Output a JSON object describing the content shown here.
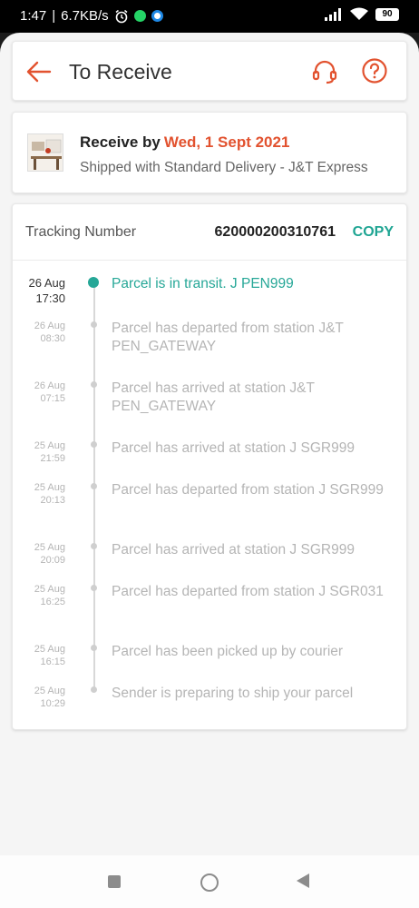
{
  "status_bar": {
    "time": "1:47",
    "separator": "|",
    "speed": "6.7KB/s",
    "battery": "90"
  },
  "header": {
    "title": "To Receive"
  },
  "delivery": {
    "title_prefix": "Receive by",
    "date": "Wed, 1 Sept 2021",
    "subtitle": "Shipped with Standard Delivery  - J&T Express"
  },
  "tracking": {
    "label": "Tracking Number",
    "number": "620000200310761",
    "copy_label": "COPY",
    "events": [
      {
        "date": "26 Aug",
        "time": "17:30",
        "text": "Parcel is in transit. J PEN999"
      },
      {
        "date": "26 Aug",
        "time": "08:30",
        "text": "Parcel has departed from station J&T PEN_GATEWAY"
      },
      {
        "date": "26 Aug",
        "time": "07:15",
        "text": "Parcel has arrived at station J&T PEN_GATEWAY"
      },
      {
        "date": "25 Aug",
        "time": "21:59",
        "text": "Parcel has arrived at station J SGR999"
      },
      {
        "date": "25 Aug",
        "time": "20:13",
        "text": "Parcel has departed from station J SGR999"
      },
      {
        "date": "25 Aug",
        "time": "20:09",
        "text": "Parcel has arrived at station J SGR999"
      },
      {
        "date": "25 Aug",
        "time": "16:25",
        "text": "Parcel has departed from station J SGR031"
      },
      {
        "date": "25 Aug",
        "time": "16:15",
        "text": "Parcel has been picked up by courier"
      },
      {
        "date": "25 Aug",
        "time": "10:29",
        "text": "Sender is preparing to ship your parcel"
      }
    ]
  },
  "colors": {
    "accent": "#e2522f",
    "teal": "#26a797",
    "muted": "#b5b5b5"
  },
  "icons": [
    "back-arrow-icon",
    "headset-icon",
    "help-icon",
    "alarm-icon",
    "whatsapp-icon",
    "phone-icon",
    "signal-icon",
    "wifi-icon",
    "battery-icon"
  ]
}
